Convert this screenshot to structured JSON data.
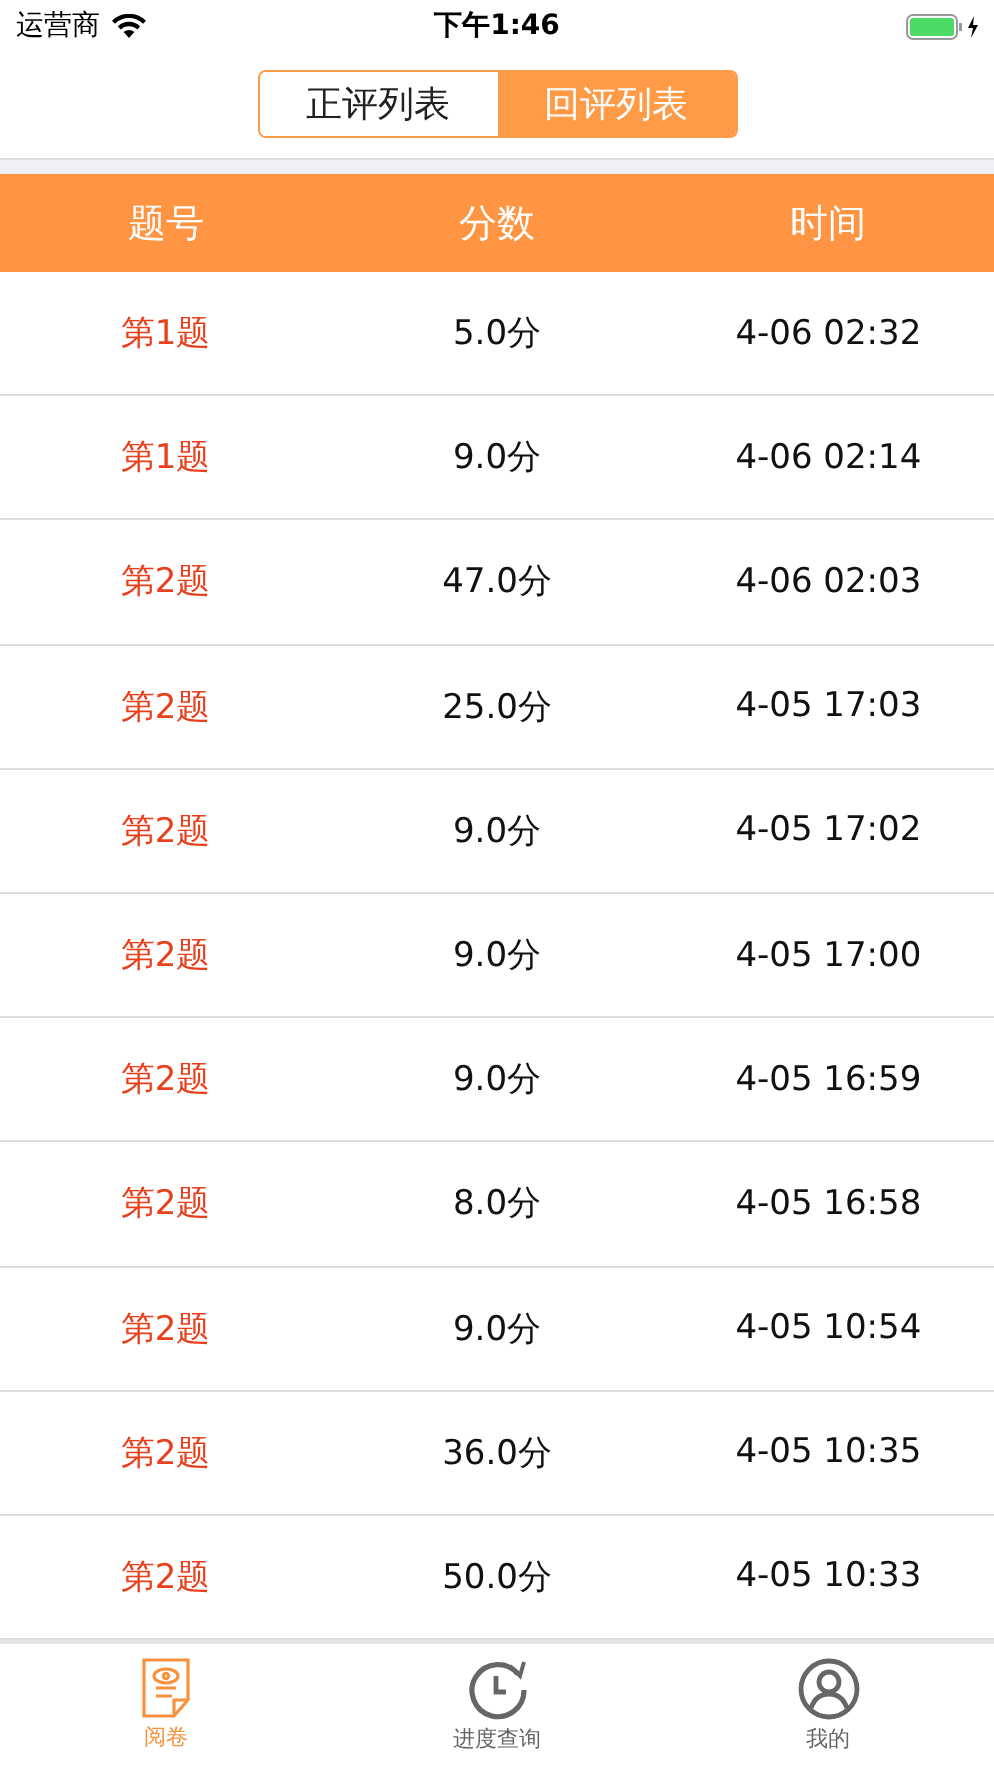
{
  "status_bar": {
    "carrier": "运营商",
    "time": "下午1:46"
  },
  "segments": [
    {
      "label": "正评列表",
      "selected": false
    },
    {
      "label": "回评列表",
      "selected": true
    }
  ],
  "table": {
    "columns": [
      "题号",
      "分数",
      "时间"
    ],
    "rows": [
      {
        "question": "第1题",
        "score": "5.0分",
        "time": "4-06 02:32"
      },
      {
        "question": "第1题",
        "score": "9.0分",
        "time": "4-06 02:14"
      },
      {
        "question": "第2题",
        "score": "47.0分",
        "time": "4-06 02:03"
      },
      {
        "question": "第2题",
        "score": "25.0分",
        "time": "4-05 17:03"
      },
      {
        "question": "第2题",
        "score": "9.0分",
        "time": "4-05 17:02"
      },
      {
        "question": "第2题",
        "score": "9.0分",
        "time": "4-05 17:00"
      },
      {
        "question": "第2题",
        "score": "9.0分",
        "time": "4-05 16:59"
      },
      {
        "question": "第2题",
        "score": "8.0分",
        "time": "4-05 16:58"
      },
      {
        "question": "第2题",
        "score": "9.0分",
        "time": "4-05 10:54"
      },
      {
        "question": "第2题",
        "score": "36.0分",
        "time": "4-05 10:35"
      },
      {
        "question": "第2题",
        "score": "50.0分",
        "time": "4-05 10:33"
      }
    ]
  },
  "tab_bar": [
    {
      "kind": "read",
      "label": "阅卷",
      "selected": true
    },
    {
      "kind": "progress",
      "label": "进度查询",
      "selected": false
    },
    {
      "kind": "profile",
      "label": "我的",
      "selected": false
    }
  ]
}
